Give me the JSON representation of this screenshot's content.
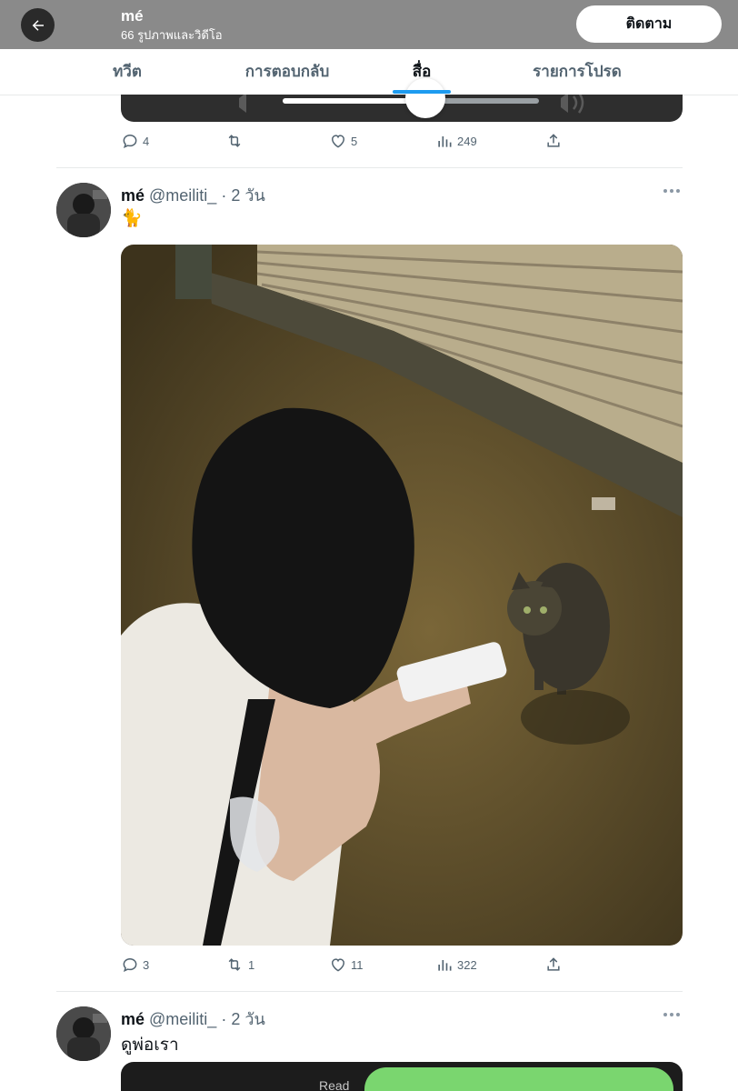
{
  "header": {
    "back_label": "←",
    "name": "mé",
    "subtitle": "66 รูปภาพและวิดีโอ",
    "follow_label": "ติดตาม"
  },
  "tabs": [
    {
      "label": "ทวีต",
      "active": false
    },
    {
      "label": "การตอบกลับ",
      "active": false
    },
    {
      "label": "สื่อ",
      "active": true
    },
    {
      "label": "รายการโปรด",
      "active": false
    }
  ],
  "accent_color": "#1d9bf0",
  "previous_tweet": {
    "media": {
      "type": "video",
      "volume_fraction": 0.55
    },
    "stats": {
      "replies": "4",
      "retweets": "",
      "likes": "5",
      "views": "249"
    }
  },
  "tweets": [
    {
      "name": "mé",
      "handle": "@meiliti_",
      "time": "· 2 วัน",
      "text": "🐈",
      "media": {
        "type": "photo",
        "description_icon": "photo"
      },
      "stats": {
        "replies": "3",
        "retweets": "1",
        "likes": "11",
        "views": "322"
      }
    },
    {
      "name": "mé",
      "handle": "@meiliti_",
      "time": "· 2 วัน",
      "text": "ดูพ่อเรา",
      "media": {
        "type": "chat-screenshot",
        "read_label": "Read"
      }
    }
  ],
  "icons": {
    "back": "arrow-left-icon",
    "reply": "reply-icon",
    "retweet": "retweet-icon",
    "like": "heart-icon",
    "views": "views-icon",
    "share": "share-icon",
    "more": "more-icon"
  }
}
